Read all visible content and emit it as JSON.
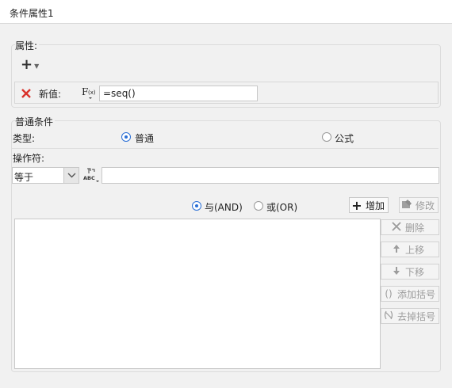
{
  "window": {
    "title": "条件属性1"
  },
  "properties": {
    "section_label": "属性:",
    "new_value_label": "新值:",
    "formula_icon_text": "F(x)",
    "new_value": "=seq()"
  },
  "condition": {
    "section_label": "普通条件",
    "type_label": "类型:",
    "type_options": [
      {
        "label": "普通",
        "selected": true
      },
      {
        "label": "公式",
        "selected": false
      }
    ],
    "operator_label": "操作符:",
    "operator_value": "等于",
    "operand_value": "",
    "logic_options": [
      {
        "label": "与(AND)",
        "selected": true
      },
      {
        "label": "或(OR)",
        "selected": false
      }
    ],
    "buttons": {
      "add": "增加",
      "modify": "修改",
      "delete": "删除",
      "move_up": "上移",
      "move_down": "下移",
      "add_bracket": "添加括号",
      "remove_bracket": "去掉括号"
    },
    "conditions_list": []
  },
  "colors": {
    "accent": "#2a6fd6",
    "delete_red": "#d9322b",
    "disabled_text": "#9c9c9c"
  }
}
